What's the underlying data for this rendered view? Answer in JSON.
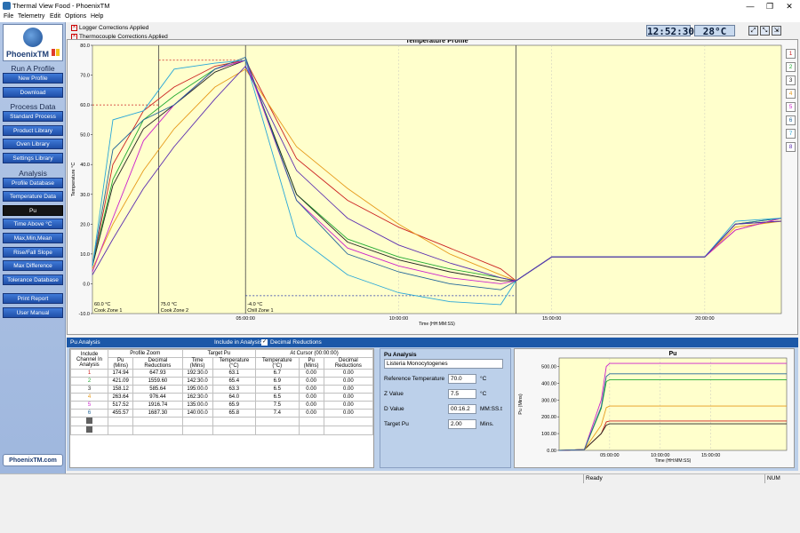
{
  "window": {
    "title": "Thermal View Food - PhoenixTM",
    "controls": [
      "—",
      "❐",
      "✕"
    ]
  },
  "menu": [
    "File",
    "Telemetry",
    "Edit",
    "Options",
    "Help"
  ],
  "sidebar": {
    "logo_text": "PhoenixTM",
    "sections": [
      {
        "title": "Run A Profile",
        "buttons": [
          "New Profile",
          "Download"
        ]
      },
      {
        "title": "Process Data",
        "buttons": [
          "Standard Process",
          "Product Library",
          "Oven Library",
          "Settings Library"
        ]
      },
      {
        "title": "Analysis",
        "buttons": [
          "Profile Database",
          "Temperature Data",
          "Pu",
          "Time Above °C",
          "Max,Min,Mean",
          "Rise/Fall Slope",
          "Max Difference",
          "Tolerance Database"
        ]
      },
      {
        "title": "",
        "buttons": [
          "Print Report",
          "User Manual"
        ]
      }
    ],
    "selected": "Pu",
    "weblink": "PhoenixTM.com"
  },
  "topstrip": {
    "logger_corr": "Logger Corrections Applied",
    "thermo_corr": "Thermocouple Corrections Applied",
    "clock": "12:52:30",
    "temp": "28°C"
  },
  "chart_data": [
    {
      "type": "line",
      "title": "Temperature Profile",
      "xlabel": "Time (HH:MM:SS)",
      "ylabel": "Temperature °C",
      "ylim": [
        -10,
        80
      ],
      "xlim": [
        0,
        1350
      ],
      "x_unit": "minutes",
      "yticks": [
        "-10.0",
        "0.0",
        "10.0",
        "20.0",
        "30.0",
        "40.0",
        "50.0",
        "60.0",
        "70.0",
        "80.0"
      ],
      "xticks": [
        {
          "v": 300,
          "label": "05:00:00"
        },
        {
          "v": 600,
          "label": "10:00:00"
        },
        {
          "v": 900,
          "label": "15:00:00"
        },
        {
          "v": 1200,
          "label": "20:00:00"
        }
      ],
      "zones": [
        {
          "start": 0,
          "end": 130,
          "setpoint": "60.0 °C",
          "name": "Cook Zone 1"
        },
        {
          "start": 130,
          "end": 300,
          "setpoint": "75.0 °C",
          "name": "Cook Zone 2"
        },
        {
          "start": 300,
          "end": 830,
          "setpoint": "-4.0 °C",
          "name": "Chill Zone 1"
        }
      ],
      "legend": [
        "1",
        "2",
        "3",
        "4",
        "5",
        "6",
        "7",
        "8"
      ],
      "series_colors": [
        "#cc2222",
        "#22aa33",
        "#222222",
        "#e69a1a",
        "#cc22cc",
        "#226699",
        "#2aa7d8",
        "#5a2cb0"
      ],
      "series": [
        {
          "x": [
            0,
            40,
            100,
            160,
            240,
            300,
            400,
            500,
            600,
            700,
            800,
            830,
            900,
            1000,
            1100,
            1200,
            1260,
            1350
          ],
          "values": [
            6,
            40,
            58,
            66,
            73,
            75,
            42,
            28,
            19,
            12,
            5,
            1,
            9,
            9,
            9,
            9,
            18,
            22
          ]
        },
        {
          "x": [
            0,
            40,
            100,
            160,
            240,
            300,
            400,
            500,
            600,
            700,
            800,
            830,
            900,
            1000,
            1100,
            1200,
            1260,
            1350
          ],
          "values": [
            6,
            35,
            55,
            63,
            72,
            75,
            30,
            15,
            9,
            5,
            2,
            1,
            9,
            9,
            9,
            9,
            20,
            22
          ]
        },
        {
          "x": [
            0,
            40,
            100,
            160,
            240,
            300,
            400,
            500,
            600,
            700,
            800,
            830,
            900,
            1000,
            1100,
            1200,
            1260,
            1350
          ],
          "values": [
            6,
            33,
            52,
            60,
            71,
            75,
            30,
            14,
            8,
            4,
            1,
            1,
            9,
            9,
            9,
            9,
            20,
            21
          ]
        },
        {
          "x": [
            0,
            40,
            100,
            160,
            240,
            300,
            400,
            500,
            600,
            700,
            800,
            830,
            900,
            1000,
            1100,
            1200,
            1260,
            1350
          ],
          "values": [
            5,
            20,
            38,
            52,
            66,
            72,
            46,
            32,
            20,
            10,
            3,
            1,
            9,
            9,
            9,
            9,
            19,
            21
          ]
        },
        {
          "x": [
            0,
            40,
            100,
            160,
            240,
            300,
            400,
            500,
            600,
            700,
            800,
            830,
            900,
            1000,
            1100,
            1200,
            1260,
            1350
          ],
          "values": [
            4,
            22,
            48,
            60,
            72,
            75,
            28,
            12,
            6,
            2,
            0,
            1,
            9,
            9,
            9,
            9,
            18,
            22
          ]
        },
        {
          "x": [
            0,
            40,
            100,
            160,
            240,
            300,
            400,
            500,
            600,
            700,
            800,
            830,
            900,
            1000,
            1100,
            1200,
            1260,
            1350
          ],
          "values": [
            6,
            45,
            55,
            60,
            72,
            76,
            28,
            10,
            4,
            0,
            -2,
            1,
            9,
            9,
            9,
            9,
            20,
            22
          ]
        },
        {
          "x": [
            0,
            40,
            100,
            160,
            240,
            300,
            400,
            500,
            600,
            700,
            800,
            830,
            900,
            1000,
            1100,
            1200,
            1260,
            1350
          ],
          "values": [
            6,
            55,
            58,
            72,
            74,
            75,
            16,
            3,
            -3,
            -6,
            -7,
            1,
            9,
            9,
            9,
            9,
            21,
            22
          ]
        },
        {
          "x": [
            0,
            40,
            100,
            160,
            240,
            300,
            400,
            500,
            600,
            700,
            800,
            830,
            900,
            1000,
            1100,
            1200,
            1260,
            1350
          ],
          "values": [
            3,
            15,
            32,
            46,
            62,
            73,
            38,
            22,
            13,
            7,
            2,
            1,
            9,
            9,
            9,
            9,
            20,
            21
          ]
        }
      ]
    },
    {
      "type": "line",
      "title": "Pu",
      "xlabel": "Time (HH:MM:SS)",
      "ylabel": "Pu (Mins)",
      "ylim": [
        0,
        550
      ],
      "xlim": [
        0,
        1350
      ],
      "yticks": [
        "0.00",
        "100.00",
        "200.00",
        "300.00",
        "400.00",
        "500.00"
      ],
      "xticks": [
        {
          "v": 300,
          "label": "05:00:00"
        },
        {
          "v": 600,
          "label": "10:00:00"
        },
        {
          "v": 900,
          "label": "15:00:00"
        }
      ],
      "series_colors": [
        "#cc2222",
        "#22aa33",
        "#222222",
        "#e69a1a",
        "#cc22cc",
        "#226699",
        "#2aa7d8",
        "#5a2cb0"
      ],
      "series": [
        {
          "x": [
            0,
            150,
            250,
            280,
            300,
            1350
          ],
          "values": [
            0,
            5,
            100,
            170,
            175,
            175
          ]
        },
        {
          "x": [
            0,
            150,
            250,
            280,
            300,
            1350
          ],
          "values": [
            0,
            5,
            250,
            410,
            421,
            421
          ]
        },
        {
          "x": [
            0,
            150,
            250,
            280,
            300,
            1350
          ],
          "values": [
            0,
            5,
            100,
            150,
            158,
            158
          ]
        },
        {
          "x": [
            0,
            150,
            250,
            280,
            300,
            1350
          ],
          "values": [
            0,
            5,
            150,
            255,
            264,
            264
          ]
        },
        {
          "x": [
            0,
            150,
            250,
            280,
            300,
            1350
          ],
          "values": [
            0,
            5,
            300,
            500,
            518,
            518
          ]
        },
        {
          "x": [
            0,
            150,
            250,
            280,
            300,
            1350
          ],
          "values": [
            0,
            5,
            260,
            440,
            456,
            456
          ]
        }
      ]
    }
  ],
  "pu_analysis": {
    "header": "Pu Analysis",
    "include_label": "Include in Analysis:",
    "decimal_label": "Decimal Reductions",
    "groups": [
      "Profile Zoom",
      "Target Pu",
      "At Cursor (00:00:00)"
    ],
    "columns": [
      "Include Channel In Analysis",
      "Pu (Mins)",
      "Decimal Reductions",
      "Time (Mins)",
      "Temperature (°C)",
      "Temperature (°C)",
      "Pu (Mins)",
      "Decimal Reductions"
    ],
    "rows": [
      [
        "1",
        "174.94",
        "647.93",
        "192:30.0",
        "63.1",
        "6.7",
        "0.00",
        "0.00"
      ],
      [
        "2",
        "421.09",
        "1559.60",
        "142:30.0",
        "65.4",
        "6.9",
        "0.00",
        "0.00"
      ],
      [
        "3",
        "158.12",
        "585.64",
        "195:00.0",
        "63.3",
        "6.5",
        "0.00",
        "0.00"
      ],
      [
        "4",
        "263.64",
        "976.44",
        "162:30.0",
        "64.0",
        "6.5",
        "0.00",
        "0.00"
      ],
      [
        "5",
        "517.52",
        "1916.74",
        "135:00.0",
        "65.9",
        "7.5",
        "0.00",
        "0.00"
      ],
      [
        "6",
        "455.57",
        "1687.30",
        "140:00.0",
        "65.8",
        "7.4",
        "0.00",
        "0.00"
      ]
    ],
    "organism": "Listeria Monocytogenes",
    "ref_temp_label": "Reference Temperature",
    "ref_temp": "70.0",
    "z_label": "Z Value",
    "z": "7.5",
    "d_label": "D Value",
    "d": "00:16.2",
    "d_unit": "MM:SS.t",
    "target_label": "Target Pu",
    "target": "2.00",
    "target_unit": "Mins.",
    "unit_c": "°C"
  },
  "status": {
    "ready": "Ready",
    "num": "NUM"
  }
}
